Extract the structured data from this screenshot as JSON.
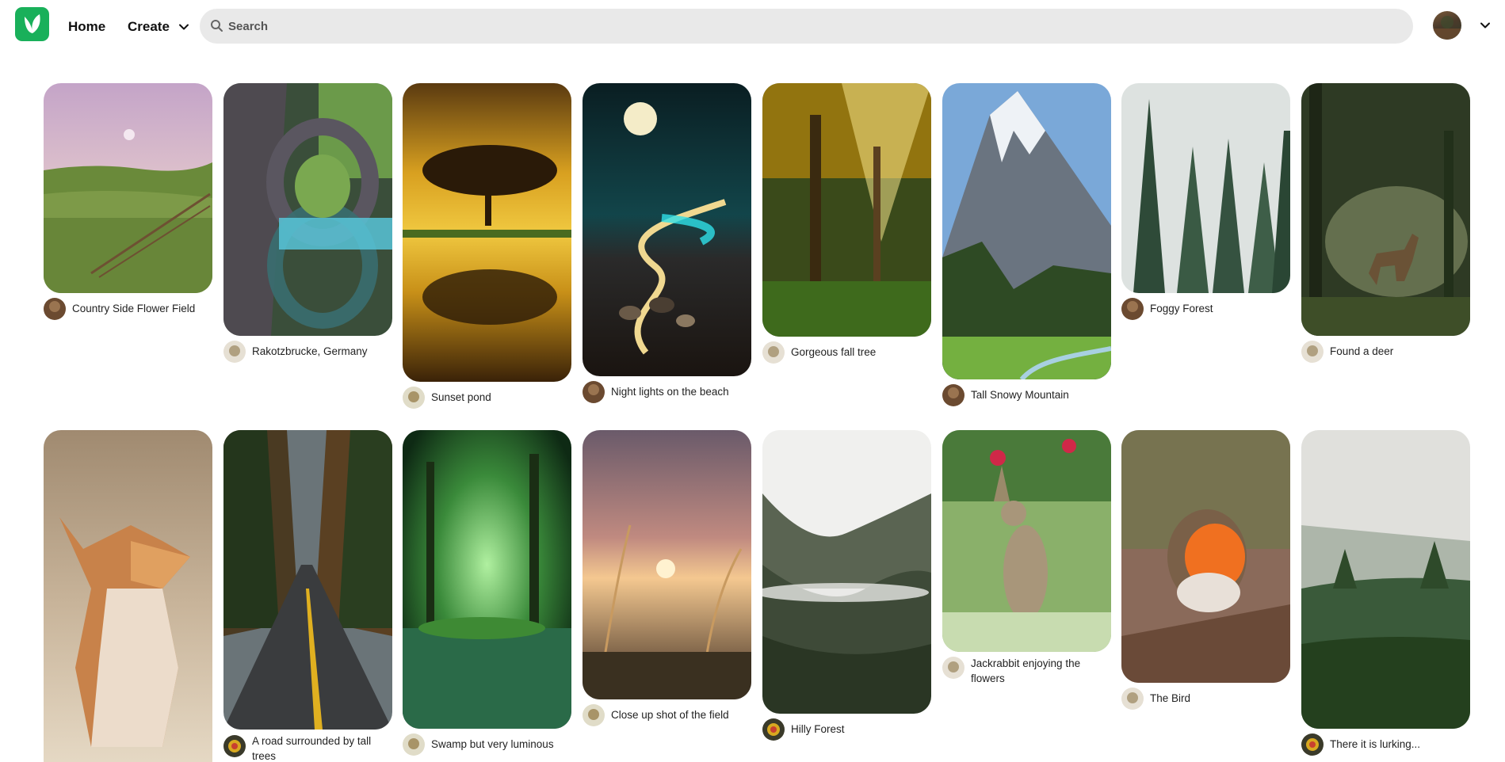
{
  "header": {
    "nav_home": "Home",
    "nav_create": "Create",
    "search_placeholder": "Search"
  },
  "colors": {
    "brand": "#19b05a",
    "search_bg": "#e9e9e9"
  },
  "icons": {
    "logo": "leaf-logo-icon",
    "create_menu": "chevron-down-icon",
    "search": "search-icon",
    "account_menu": "chevron-down-icon"
  },
  "pins": [
    {
      "title": "Country Side Flower Field"
    },
    {
      "title": "Rakotzbrucke, Germany"
    },
    {
      "title": "Sunset pond"
    },
    {
      "title": "Night lights on the beach"
    },
    {
      "title": "Gorgeous fall tree"
    },
    {
      "title": "Tall Snowy Mountain"
    },
    {
      "title": "Foggy Forest"
    },
    {
      "title": "Found a deer"
    },
    {
      "title": ""
    },
    {
      "title": "A road surrounded by tall trees"
    },
    {
      "title": "Swamp but very luminous"
    },
    {
      "title": "Close up shot of the field"
    },
    {
      "title": "Hilly Forest"
    },
    {
      "title": "Jackrabbit enjoying the flowers"
    },
    {
      "title": "The Bird"
    },
    {
      "title": "There it is lurking..."
    }
  ]
}
